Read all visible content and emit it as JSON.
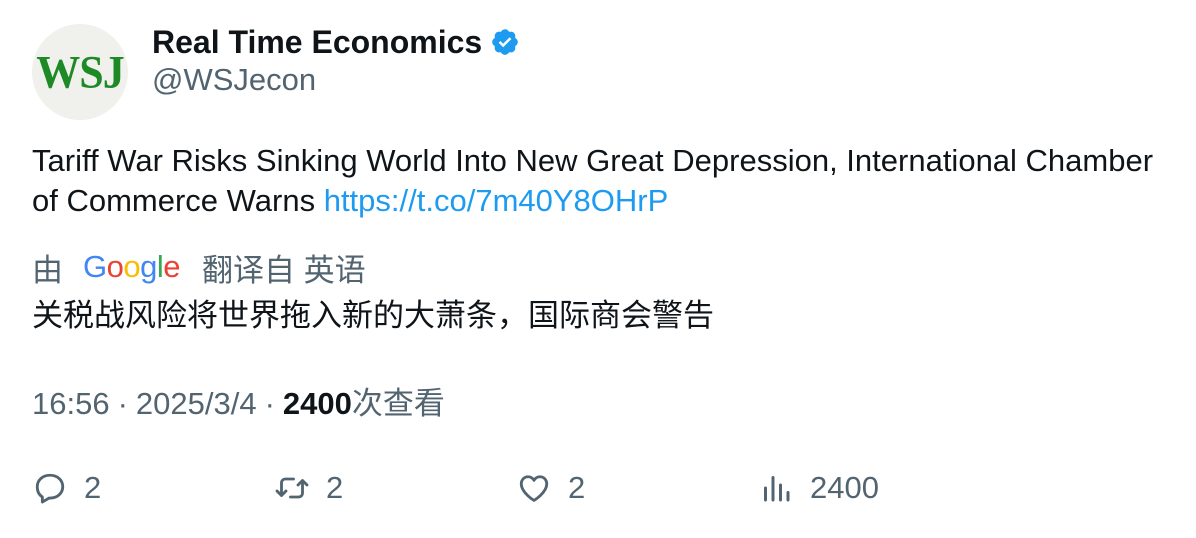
{
  "author": {
    "avatar_text": "WSJ",
    "display_name": "Real Time Economics",
    "handle": "@WSJecon",
    "verified_icon": "verified-badge-icon",
    "verified_color": "#1d9bf0"
  },
  "tweet": {
    "text": "Tariff War Risks Sinking World Into New Great Depression, International Chamber of Commerce Warns",
    "link": "https://t.co/7m40Y8OHrP",
    "link_color": "#1d9bf0"
  },
  "translation": {
    "prefix": "由",
    "provider_letters": [
      "G",
      "o",
      "o",
      "g",
      "l",
      "e"
    ],
    "provider_colors": [
      "#4285F4",
      "#EA4335",
      "#FBBC05",
      "#4285F4",
      "#34A853",
      "#EA4335"
    ],
    "suffix": "翻译自 英语",
    "text": "关税战风险将世界拖入新的大萧条，国际商会警告"
  },
  "meta": {
    "time": "16:56",
    "sep": "·",
    "date": "2025/3/4",
    "views_count": "2400",
    "views_label": "次查看"
  },
  "actions": {
    "reply": {
      "icon": "reply-icon",
      "count": "2"
    },
    "retweet": {
      "icon": "retweet-icon",
      "count": "2"
    },
    "like": {
      "icon": "heart-icon",
      "count": "2"
    },
    "views": {
      "icon": "bar-chart-icon",
      "count": "2400"
    }
  }
}
